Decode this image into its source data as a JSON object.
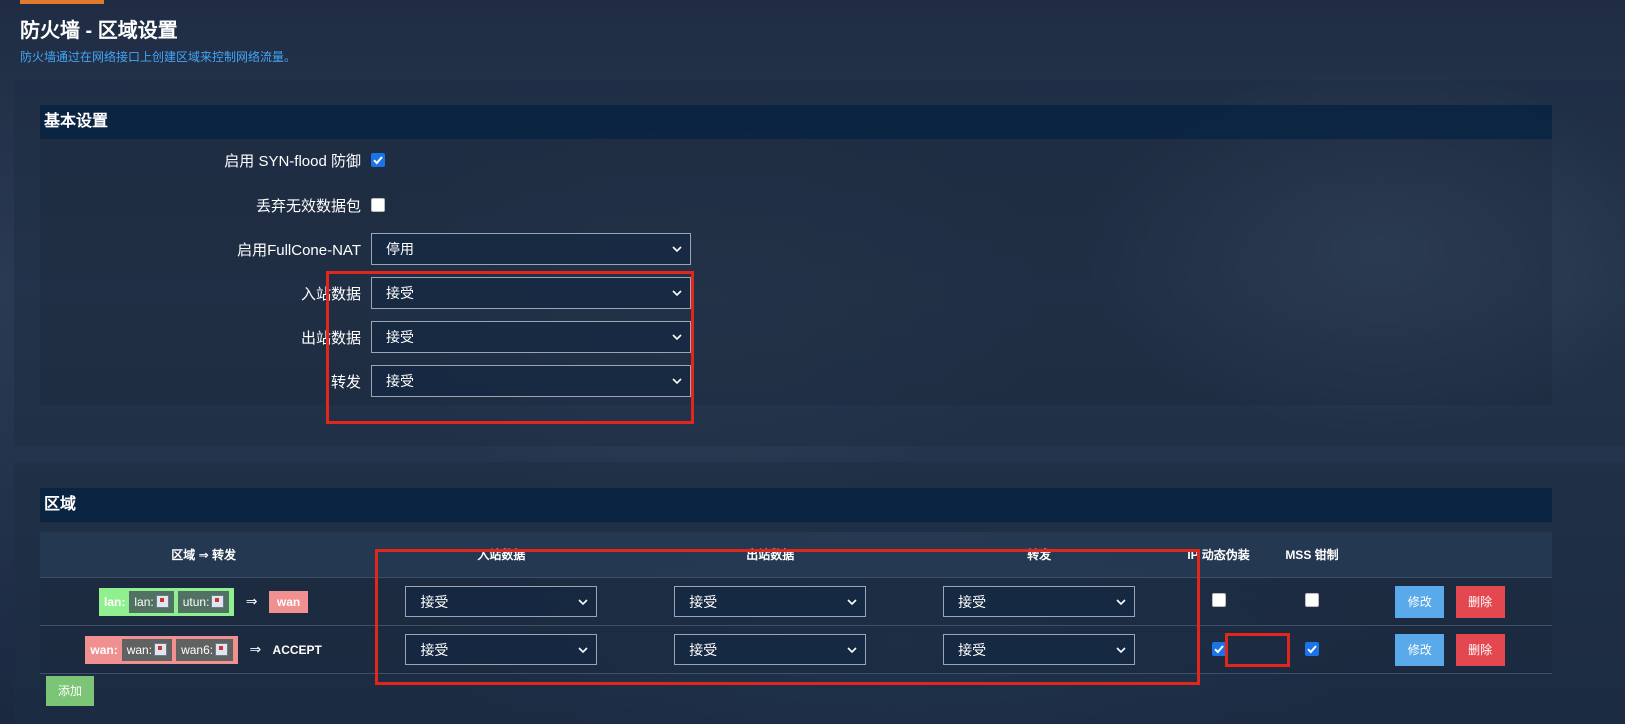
{
  "header": {
    "title": "防火墙 - 区域设置",
    "description": "防火墙通过在网络接口上创建区域来控制网络流量。"
  },
  "basic": {
    "section_title": "基本设置",
    "syn_flood": {
      "label": "启用 SYN-flood 防御",
      "checked": true
    },
    "drop_invalid": {
      "label": "丢弃无效数据包",
      "checked": false
    },
    "fullcone": {
      "label": "启用FullCone-NAT",
      "value": "停用"
    },
    "input": {
      "label": "入站数据",
      "value": "接受"
    },
    "output": {
      "label": "出站数据",
      "value": "接受"
    },
    "forward": {
      "label": "转发",
      "value": "接受"
    }
  },
  "zones": {
    "section_title": "区域",
    "columns": {
      "zone_forward": "区域 ⇒ 转发",
      "input": "入站数据",
      "output": "出站数据",
      "forward": "转发",
      "masq": "IP 动态伪装",
      "mss": "MSS 钳制"
    },
    "rows": [
      {
        "zone": "lan:",
        "nets": [
          "lan:",
          "utun:"
        ],
        "arrow": "⇒",
        "dest": "wan",
        "input": "接受",
        "output": "接受",
        "forward": "接受",
        "masq": false,
        "mss": false
      },
      {
        "zone": "wan:",
        "nets": [
          "wan:",
          "wan6:"
        ],
        "arrow": "⇒",
        "dest": "ACCEPT",
        "input": "接受",
        "output": "接受",
        "forward": "接受",
        "masq": true,
        "mss": true
      }
    ],
    "edit_label": "修改",
    "delete_label": "删除",
    "add_label": "添加"
  },
  "colors": {
    "accent_blue": "#43a5f5",
    "highlight_red": "#e1261c",
    "zone_lan": "#90f090",
    "zone_wan": "#f09090",
    "btn_edit": "#5aa9ea",
    "btn_delete": "#e34850",
    "btn_add": "#7cc576"
  },
  "icons": {
    "checkbox_checked": "check-icon",
    "select_arrow": "chevron-down-icon",
    "network": "network-icon"
  }
}
